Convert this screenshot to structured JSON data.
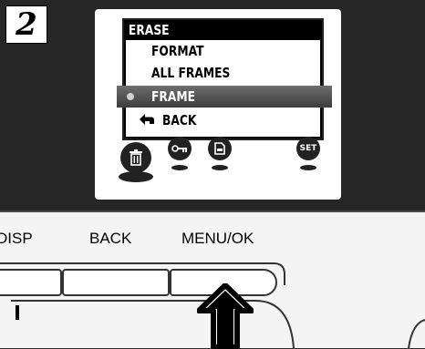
{
  "step": {
    "number": "2"
  },
  "menu": {
    "title": "ERASE",
    "items": [
      {
        "label": "FORMAT",
        "selected": false
      },
      {
        "label": "ALL FRAMES",
        "selected": false
      },
      {
        "label": "FRAME",
        "selected": true
      },
      {
        "label": "BACK",
        "selected": false
      }
    ]
  },
  "mode_icons": [
    {
      "name": "trash-icon",
      "active": true
    },
    {
      "name": "key-icon",
      "active": false
    },
    {
      "name": "print-icon",
      "active": false
    },
    {
      "name": "set-icon",
      "label": "SET",
      "active": false
    }
  ],
  "camera_buttons": {
    "disp": "DISP",
    "back": "BACK",
    "menu_ok": "MENU/OK"
  },
  "colors": {
    "panel": "#262626",
    "screen": "#ffffff",
    "highlight": "#555555",
    "body": "#f4f4f4"
  }
}
